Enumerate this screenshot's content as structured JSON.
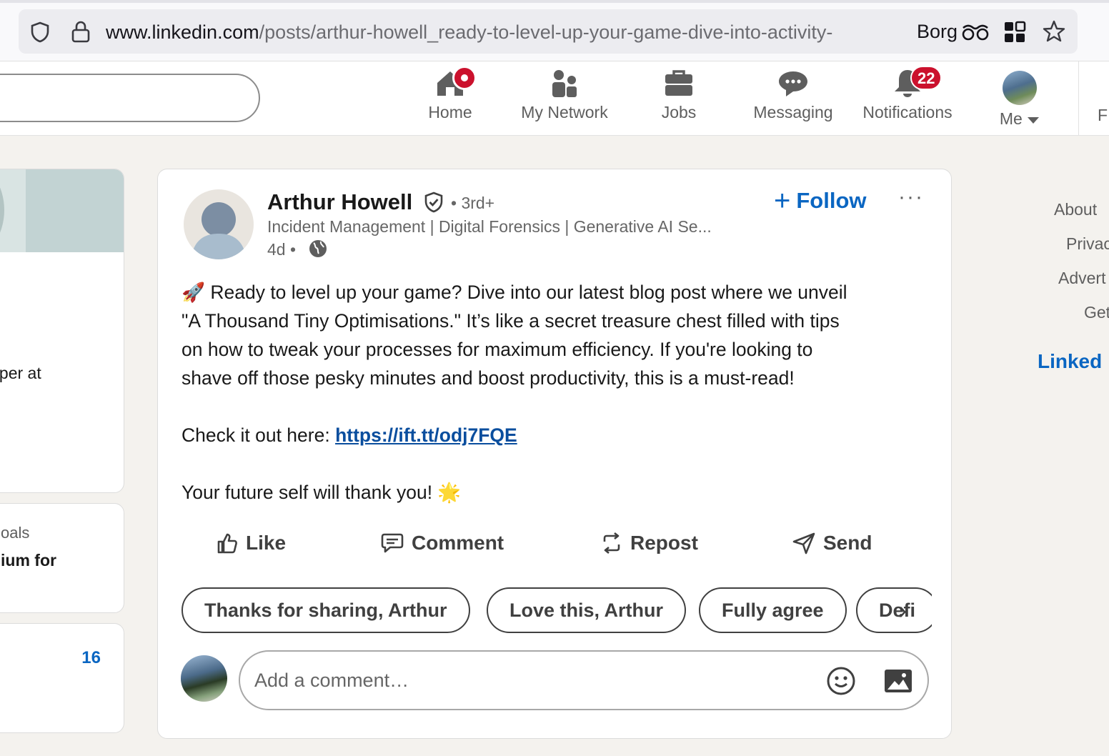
{
  "browser": {
    "url_host": "www.linkedin.com",
    "url_path": "/posts/arthur-howell_ready-to-level-up-your-game-dive-into-activity-",
    "profile_label": "Borg"
  },
  "nav": {
    "items": [
      {
        "label": "Home",
        "icon": "home-icon"
      },
      {
        "label": "My Network",
        "icon": "my-network-icon"
      },
      {
        "label": "Jobs",
        "icon": "jobs-icon"
      },
      {
        "label": "Messaging",
        "icon": "messaging-icon"
      },
      {
        "label": "Notifications",
        "icon": "bell-icon",
        "badge": "22"
      },
      {
        "label": "Me",
        "icon": "avatar"
      }
    ],
    "cut_label": "F"
  },
  "left": {
    "profile_text": "loper at",
    "premium_line1": "oals",
    "premium_line2": "ium for",
    "stat_value": "16"
  },
  "post": {
    "author": "Arthur Howell",
    "degree": "• 3rd+",
    "headline": "Incident Management | Digital Forensics | Generative AI Se...",
    "time": "4d •",
    "follow_label": "Follow",
    "more_label": "···",
    "body_lines": [
      "🚀 Ready to level up your game? Dive into our latest blog post where we unveil",
      "\"A Thousand Tiny Optimisations.\" It’s like a secret treasure chest filled with tips",
      "on how to tweak your processes for maximum efficiency. If you're looking to",
      "shave off those pesky minutes and boost productivity, this is a must-read!"
    ],
    "check_prefix": "Check it out here: ",
    "link": "https://ift.tt/odj7FQE",
    "closing": "Your future self will thank you! 🌟",
    "actions": [
      "Like",
      "Comment",
      "Repost",
      "Send"
    ],
    "chips": [
      "Thanks for sharing, Arthur",
      "Love this, Arthur",
      "Fully agree",
      "Defi"
    ],
    "comment_placeholder": "Add a comment…"
  },
  "right": {
    "links": [
      "About",
      "Privac",
      "Advert",
      "Get"
    ],
    "logo": "Linked"
  },
  "colors": {
    "accent": "#0a66c2",
    "badge": "#cb112d",
    "background": "#f4f2ee"
  }
}
